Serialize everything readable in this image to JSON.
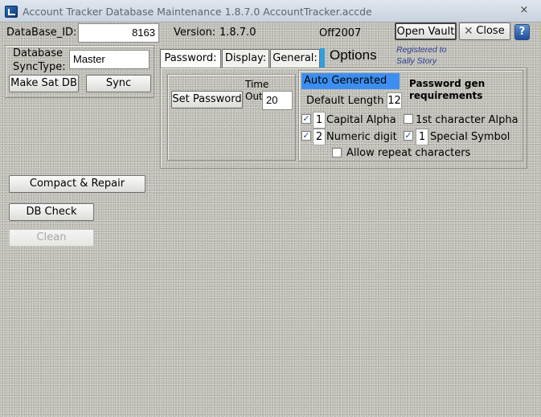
{
  "window": {
    "title": "Account Tracker Database Maintenance 1.8.7.0  AccountTracker.accde",
    "close_glyph": "×"
  },
  "header": {
    "db_id_label": "DataBase_ID:",
    "db_id_value": "8163",
    "version_label": "Version:",
    "version_value": "1.8.7.0",
    "office_label": "Off2007",
    "open_vault_label": "Open Vault",
    "close_label": "Close",
    "help_label": "?"
  },
  "sync": {
    "label_line1": "Database",
    "label_line2": "SyncType:",
    "value": "Master",
    "make_sat_label": "Make Sat DB",
    "sync_label": "Sync"
  },
  "tabs": [
    {
      "label": "Password:"
    },
    {
      "label": "Display:"
    },
    {
      "label": "General:"
    }
  ],
  "options_title": "Options",
  "registered": {
    "line1": "Registered to",
    "line2": "Sally Story"
  },
  "password": {
    "set_password_label": "Set Password",
    "timeout_line1": "Time",
    "timeout_line2": "Out",
    "timeout_value": "20",
    "auto_generated": "Auto Generated",
    "requirements_line1": "Password gen",
    "requirements_line2": "requirements",
    "default_length_label": "Default Length",
    "default_length_value": "12",
    "capital_alpha": {
      "checked": true,
      "count": "1",
      "label": "Capital Alpha"
    },
    "first_char_alpha": {
      "checked": false,
      "label": "1st character Alpha"
    },
    "numeric_digit": {
      "checked": true,
      "count": "2",
      "label": "Numeric digit"
    },
    "special_symbol": {
      "checked": true,
      "count": "1",
      "label": "Special Symbol"
    },
    "allow_repeat": {
      "checked": false,
      "label": "Allow repeat characters"
    }
  },
  "actions": {
    "compact_repair_label": "Compact & Repair",
    "db_check_label": "DB Check",
    "clean_label": "Clean"
  },
  "icons": {
    "app": "app-icon",
    "help": "help-icon",
    "close": "close-icon"
  },
  "colors": {
    "auto_generated_bg": "#3c8ff0",
    "tab_accent": "#2e9fe0",
    "registered_text": "#2b3c90"
  }
}
